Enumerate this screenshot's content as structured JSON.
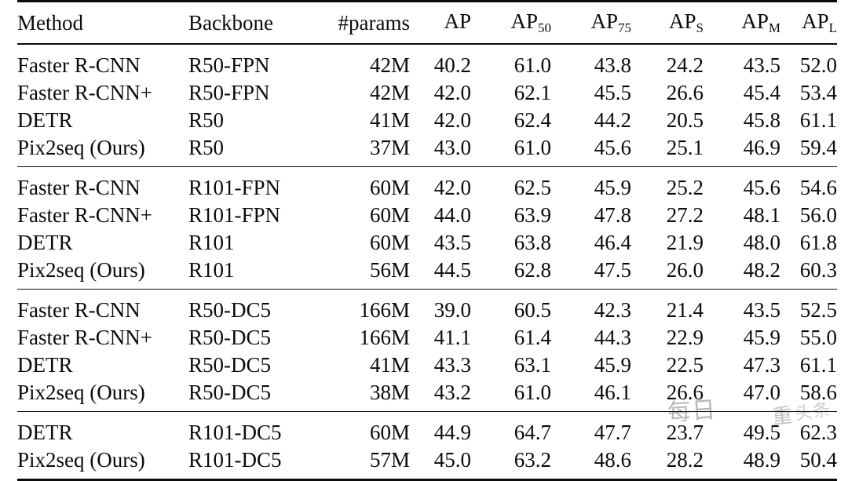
{
  "table": {
    "columns": [
      {
        "key": "method",
        "label": "Method",
        "align": "left"
      },
      {
        "key": "backbone",
        "label": "Backbone",
        "align": "left"
      },
      {
        "key": "params",
        "label": "#params",
        "align": "right"
      },
      {
        "key": "ap",
        "label": "AP",
        "sub": "",
        "align": "right"
      },
      {
        "key": "ap50",
        "label": "AP",
        "sub": "50",
        "align": "right"
      },
      {
        "key": "ap75",
        "label": "AP",
        "sub": "75",
        "align": "right"
      },
      {
        "key": "aps",
        "label": "AP",
        "sub": "S",
        "align": "right"
      },
      {
        "key": "apm",
        "label": "AP",
        "sub": "M",
        "align": "right"
      },
      {
        "key": "apl",
        "label": "AP",
        "sub": "L",
        "align": "right"
      }
    ],
    "blocks": [
      {
        "rows": [
          {
            "method": "Faster R-CNN",
            "backbone": "R50-FPN",
            "params": "42M",
            "ap": "40.2",
            "ap_bold": false,
            "ap50": "61.0",
            "ap75": "43.8",
            "aps": "24.2",
            "apm": "43.5",
            "apl": "52.0"
          },
          {
            "method": "Faster R-CNN+",
            "backbone": "R50-FPN",
            "params": "42M",
            "ap": "42.0",
            "ap_bold": false,
            "ap50": "62.1",
            "ap75": "45.5",
            "aps": "26.6",
            "apm": "45.4",
            "apl": "53.4"
          },
          {
            "method": "DETR",
            "backbone": "R50",
            "params": "41M",
            "ap": "42.0",
            "ap_bold": false,
            "ap50": "62.4",
            "ap75": "44.2",
            "aps": "20.5",
            "apm": "45.8",
            "apl": "61.1"
          },
          {
            "method": "Pix2seq (Ours)",
            "backbone": "R50",
            "params": "37M",
            "ap": "43.0",
            "ap_bold": true,
            "ap50": "61.0",
            "ap75": "45.6",
            "aps": "25.1",
            "apm": "46.9",
            "apl": "59.4"
          }
        ]
      },
      {
        "rows": [
          {
            "method": "Faster R-CNN",
            "backbone": "R101-FPN",
            "params": "60M",
            "ap": "42.0",
            "ap_bold": false,
            "ap50": "62.5",
            "ap75": "45.9",
            "aps": "25.2",
            "apm": "45.6",
            "apl": "54.6"
          },
          {
            "method": "Faster R-CNN+",
            "backbone": "R101-FPN",
            "params": "60M",
            "ap": "44.0",
            "ap_bold": false,
            "ap50": "63.9",
            "ap75": "47.8",
            "aps": "27.2",
            "apm": "48.1",
            "apl": "56.0"
          },
          {
            "method": "DETR",
            "backbone": "R101",
            "params": "60M",
            "ap": "43.5",
            "ap_bold": false,
            "ap50": "63.8",
            "ap75": "46.4",
            "aps": "21.9",
            "apm": "48.0",
            "apl": "61.8"
          },
          {
            "method": "Pix2seq (Ours)",
            "backbone": "R101",
            "params": "56M",
            "ap": "44.5",
            "ap_bold": true,
            "ap50": "62.8",
            "ap75": "47.5",
            "aps": "26.0",
            "apm": "48.2",
            "apl": "60.3"
          }
        ]
      },
      {
        "rows": [
          {
            "method": "Faster R-CNN",
            "backbone": "R50-DC5",
            "params": "166M",
            "ap": "39.0",
            "ap_bold": false,
            "ap50": "60.5",
            "ap75": "42.3",
            "aps": "21.4",
            "apm": "43.5",
            "apl": "52.5"
          },
          {
            "method": "Faster R-CNN+",
            "backbone": "R50-DC5",
            "params": "166M",
            "ap": "41.1",
            "ap_bold": false,
            "ap50": "61.4",
            "ap75": "44.3",
            "aps": "22.9",
            "apm": "45.9",
            "apl": "55.0"
          },
          {
            "method": "DETR",
            "backbone": "R50-DC5",
            "params": "41M",
            "ap": "43.3",
            "ap_bold": true,
            "ap50": "63.1",
            "ap75": "45.9",
            "aps": "22.5",
            "apm": "47.3",
            "apl": "61.1"
          },
          {
            "method": "Pix2seq (Ours)",
            "backbone": "R50-DC5",
            "params": "38M",
            "ap": "43.2",
            "ap_bold": true,
            "ap50": "61.0",
            "ap75": "46.1",
            "aps": "26.6",
            "apm": "47.0",
            "apl": "58.6"
          }
        ]
      },
      {
        "rows": [
          {
            "method": "DETR",
            "backbone": "R101-DC5",
            "params": "60M",
            "ap": "44.9",
            "ap_bold": true,
            "ap50": "64.7",
            "ap75": "47.7",
            "aps": "23.7",
            "apm": "49.5",
            "apl": "62.3"
          },
          {
            "method": "Pix2seq (Ours)",
            "backbone": "R101-DC5",
            "params": "57M",
            "ap": "45.0",
            "ap_bold": true,
            "ap50": "63.2",
            "ap75": "48.6",
            "aps": "28.2",
            "apm": "48.9",
            "apl": "50.4"
          }
        ]
      }
    ]
  },
  "watermark": {
    "line_a": "每日",
    "line_b": "重",
    "line_c": "头条"
  }
}
